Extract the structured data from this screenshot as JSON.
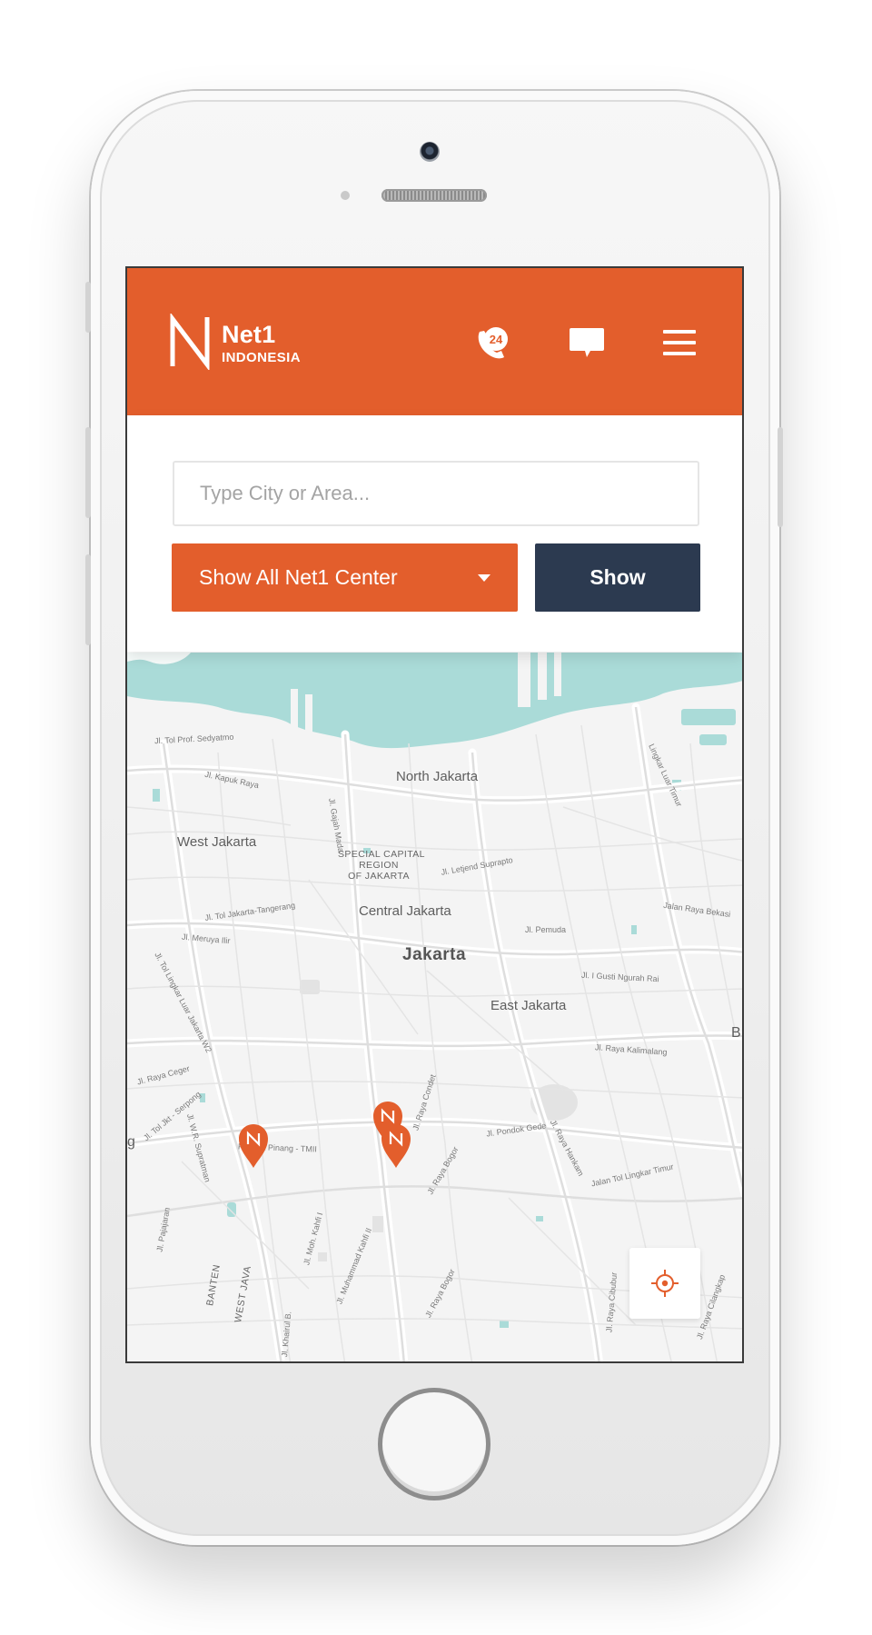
{
  "header": {
    "brand_name": "Net1",
    "brand_subtitle": "INDONESIA",
    "call_badge": "24",
    "icons": {
      "call": "phone-24-icon",
      "chat": "chat-bubble-icon",
      "menu": "hamburger-menu-icon"
    },
    "color": "#e35e2c"
  },
  "search": {
    "placeholder": "Type City or Area...",
    "value": "",
    "filter_selected": "Show All Net1 Center",
    "show_label": "Show",
    "show_color": "#2c3a50"
  },
  "map": {
    "areas": [
      "North Jakarta",
      "West Jakarta",
      "Central Jakarta",
      "East Jakarta"
    ],
    "city": "Jakarta",
    "region_lines": [
      "SPECIAL CAPITAL",
      "REGION",
      "OF JAKARTA"
    ],
    "edge_labels": [
      "B",
      "g"
    ],
    "streets": [
      "Jl. Tol Prof. Sedyatmo",
      "Jl. Kapuk Raya",
      "Jl. Gajah Mada",
      "Jl. Letjend Suprapto",
      "Lingkar Luar Timur",
      "Jl. Tol Jakarta-Tangerang",
      "Jl. Meruya Ilir",
      "Jl. Pemuda",
      "Jalan Raya Bekasi",
      "Jl. Tol Lingkar Luar Jakarta W2",
      "Jl. I Gusti Ngurah Rai",
      "Jl. Raya Kalimalang",
      "Jl. Raya Ceger",
      "Jl. Tol Jkt - Serpong",
      "Jl. W.R. Supratman",
      "Pondok Pinang - TMII",
      "Jl. Raya Condet",
      "Jl. Pondok Gede",
      "Jl. Raya Hankam",
      "Jalan Tol Lingkar Timur",
      "Jl. Raya Bogor",
      "Jl. Pajajaran",
      "Jl. Moh. Kahfi I",
      "Jl. Muhammad Kahfi II",
      "Jl. Raya Bogor",
      "Jl. Raya Cibubur",
      "Jl. Raya Cilangkap",
      "Jl. Khairul B."
    ],
    "province_labels": [
      "BANTEN",
      "WEST JAVA"
    ],
    "marker_count": 3,
    "locate_icon": "crosshair-locate-icon"
  }
}
